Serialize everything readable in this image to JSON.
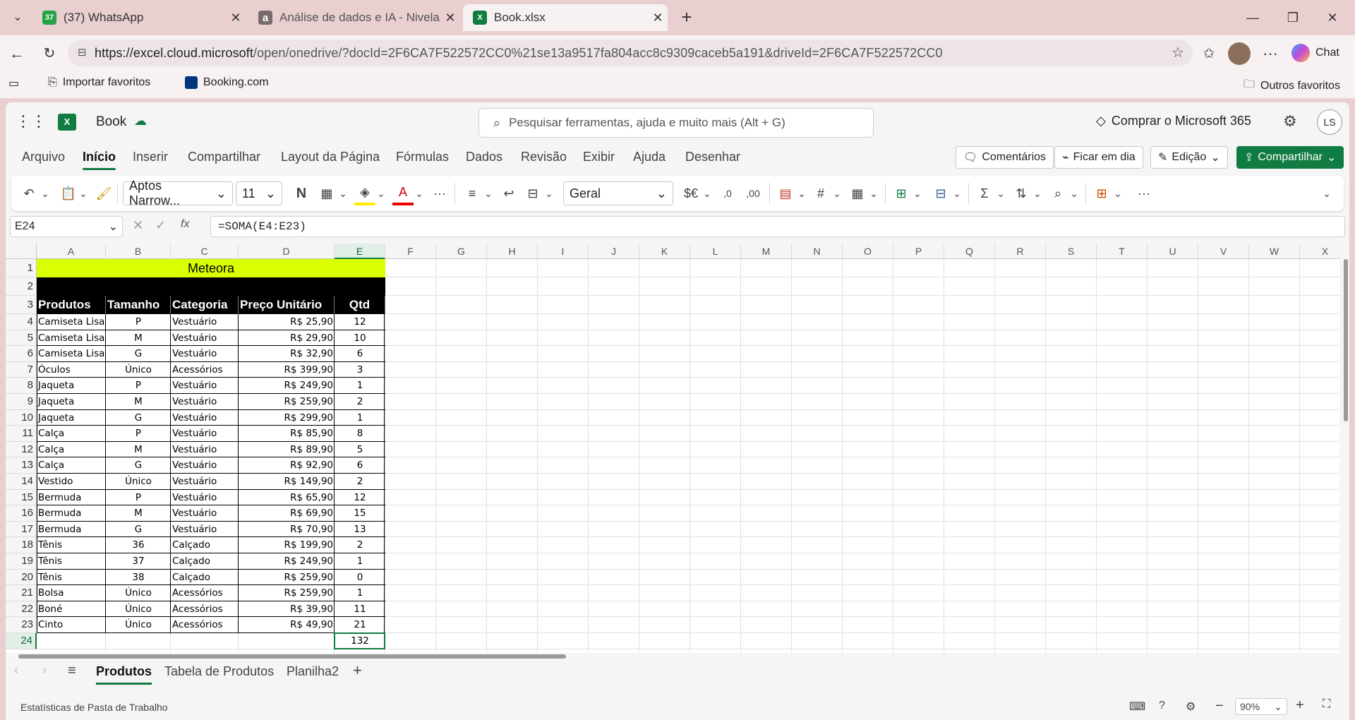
{
  "browser": {
    "tabs": [
      {
        "title": "(37) WhatsApp",
        "badge": "37",
        "icon": "whatsapp-icon"
      },
      {
        "title": "Análise de dados e IA - Nivelamento",
        "icon": "alura-icon"
      },
      {
        "title": "Book.xlsx",
        "icon": "excel-icon"
      }
    ],
    "url_host": "https://excel.cloud.microsoft",
    "url_path": "/open/onedrive/?docId=2F6CA7F522572CC0%21se13a9517fa804acc8c9309caceb5a191&driveId=2F6CA7F522572CC0",
    "chat_label": "Chat",
    "favorites": [
      "Importar favoritos",
      "Booking.com"
    ],
    "other_favorites": "Outros favoritos"
  },
  "excel": {
    "doc_name": "Book",
    "search_placeholder": "Pesquisar ferramentas, ajuda e muito mais (Alt + G)",
    "buy_label": "Comprar o Microsoft 365",
    "avatar_initials": "LS",
    "menu": [
      "Arquivo",
      "Início",
      "Inserir",
      "Compartilhar",
      "Layout da Página",
      "Fórmulas",
      "Dados",
      "Revisão",
      "Exibir",
      "Ajuda",
      "Desenhar"
    ],
    "active_menu": "Início",
    "comments_label": "Comentários",
    "catchup_label": "Ficar em dia",
    "edit_label": "Edição",
    "share_label": "Compartilhar",
    "font_name": "Aptos Narrow...",
    "font_size": "11",
    "bold_label": "N",
    "number_format": "Geral",
    "currency_label": "$€",
    "name_box": "E24",
    "fx_label": "fx",
    "formula": "=SOMA(E4:E23)",
    "columns": [
      "A",
      "B",
      "C",
      "D",
      "E",
      "F",
      "G",
      "H",
      "I",
      "J",
      "K",
      "L",
      "M",
      "N",
      "O",
      "P",
      "Q",
      "R",
      "S",
      "T",
      "U",
      "V",
      "W",
      "X"
    ],
    "rows": [
      "1",
      "2",
      "3",
      "4",
      "5",
      "6",
      "7",
      "8",
      "9",
      "10",
      "11",
      "12",
      "13",
      "14",
      "15",
      "16",
      "17",
      "18",
      "19",
      "20",
      "21",
      "22",
      "23",
      "24"
    ],
    "table_title": "Meteora",
    "headers": [
      "Produtos",
      "Tamanho",
      "Categoria",
      "Preço Unitário",
      "Qtd"
    ],
    "data": [
      [
        "Camiseta Lisa",
        "P",
        "Vestuário",
        "R$ 25,90",
        "12"
      ],
      [
        "Camiseta Lisa",
        "M",
        "Vestuário",
        "R$ 29,90",
        "10"
      ],
      [
        "Camiseta Lisa",
        "G",
        "Vestuário",
        "R$ 32,90",
        "6"
      ],
      [
        "Óculos",
        "Único",
        "Acessórios",
        "R$ 399,90",
        "3"
      ],
      [
        "Jaqueta",
        "P",
        "Vestuário",
        "R$ 249,90",
        "1"
      ],
      [
        "Jaqueta",
        "M",
        "Vestuário",
        "R$ 259,90",
        "2"
      ],
      [
        "Jaqueta",
        "G",
        "Vestuário",
        "R$ 299,90",
        "1"
      ],
      [
        "Calça",
        "P",
        "Vestuário",
        "R$ 85,90",
        "8"
      ],
      [
        "Calça",
        "M",
        "Vestuário",
        "R$ 89,90",
        "5"
      ],
      [
        "Calça",
        "G",
        "Vestuário",
        "R$ 92,90",
        "6"
      ],
      [
        "Vestido",
        "Único",
        "Vestuário",
        "R$ 149,90",
        "2"
      ],
      [
        "Bermuda",
        "P",
        "Vestuário",
        "R$ 65,90",
        "12"
      ],
      [
        "Bermuda",
        "M",
        "Vestuário",
        "R$ 69,90",
        "15"
      ],
      [
        "Bermuda",
        "G",
        "Vestuário",
        "R$ 70,90",
        "13"
      ],
      [
        "Tênis",
        "36",
        "Calçado",
        "R$ 199,90",
        "2"
      ],
      [
        "Tênis",
        "37",
        "Calçado",
        "R$ 249,90",
        "1"
      ],
      [
        "Tênis",
        "38",
        "Calçado",
        "R$ 259,90",
        "0"
      ],
      [
        "Bolsa",
        "Único",
        "Acessórios",
        "R$ 259,90",
        "1"
      ],
      [
        "Boné",
        "Único",
        "Acessórios",
        "R$ 39,90",
        "11"
      ],
      [
        "Cinto",
        "Único",
        "Acessórios",
        "R$ 49,90",
        "21"
      ]
    ],
    "total": "132",
    "sheets": [
      "Produtos",
      "Tabela de Produtos",
      "Planilha2"
    ],
    "active_sheet": "Produtos",
    "status_left": "Estatísticas de Pasta de Trabalho",
    "zoom": "90%",
    "colors": {
      "title_fill": "#d9ff00",
      "header_fill": "#000000",
      "accent": "#107c41"
    }
  }
}
